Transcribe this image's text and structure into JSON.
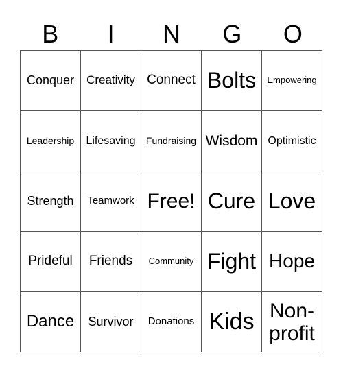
{
  "header": [
    "B",
    "I",
    "N",
    "G",
    "O"
  ],
  "cells": [
    [
      "Conquer",
      "Creativity",
      "Connect",
      "Bolts",
      "Empowering"
    ],
    [
      "Leadership",
      "Lifesaving",
      "Fundraising",
      "Wisdom",
      "Optimistic"
    ],
    [
      "Strength",
      "Teamwork",
      "Free!",
      "Cure",
      "Love"
    ],
    [
      "Prideful",
      "Friends",
      "Community",
      "Fight",
      "Hope"
    ],
    [
      "Dance",
      "Survivor",
      "Donations",
      "Kids",
      "Non-profit"
    ]
  ]
}
